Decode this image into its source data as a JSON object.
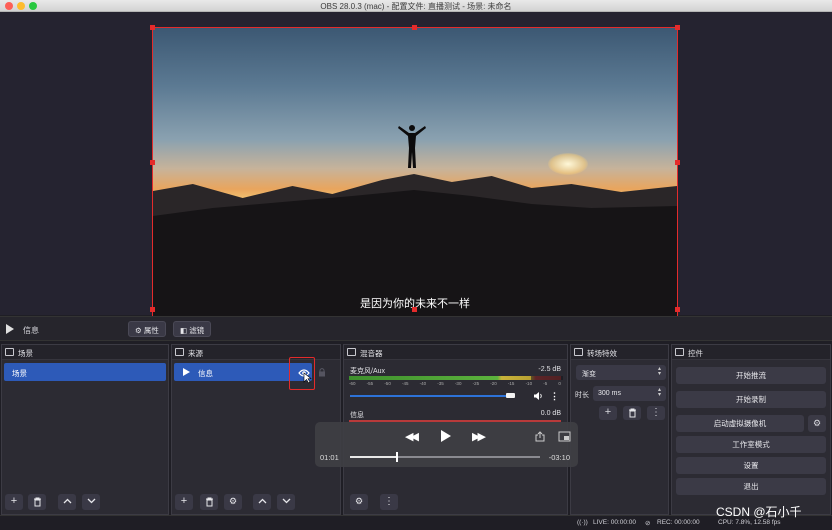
{
  "window": {
    "title": "OBS 28.0.3 (mac) - 配置文件: 直播测试 - 场景: 未命名"
  },
  "preview": {
    "subtitle": "是因为你的未来不一样"
  },
  "context_bar": {
    "source_name": "信息",
    "properties_label": "属性",
    "filters_label": "滤镜"
  },
  "docks": {
    "scenes": {
      "title": "场景",
      "items": [
        {
          "label": "场景",
          "selected": true
        }
      ]
    },
    "sources": {
      "title": "来源",
      "items": [
        {
          "label": "信息",
          "selected": true,
          "visible": true,
          "locked": false
        }
      ]
    },
    "mixer": {
      "title": "混音器",
      "channels": [
        {
          "name": "麦克风/Aux",
          "db": "-2.5 dB",
          "level": 0.85,
          "volume": 0.93
        },
        {
          "name": "信息",
          "db": "0.0 dB"
        }
      ],
      "ticks": [
        "-60",
        "-55",
        "-50",
        "-45",
        "-40",
        "-35",
        "-30",
        "-25",
        "-20",
        "-15",
        "-10",
        "-5",
        "0"
      ]
    },
    "transitions": {
      "title": "转场特效",
      "selected": "渐变",
      "duration_label": "时长",
      "duration_value": "300 ms"
    },
    "controls": {
      "title": "控件",
      "buttons": [
        "开始推流",
        "开始录制",
        "启动虚拟摄像机",
        "工作室模式",
        "设置",
        "退出"
      ]
    }
  },
  "player": {
    "elapsed": "01:01",
    "remaining": "-03:10",
    "progress": 0.24
  },
  "status": {
    "live": "LIVE: 00:00:00",
    "rec": "REC: 00:00:00",
    "cpu": "CPU: 7.8%, 12.58 fps"
  },
  "watermark": "CSDN @石小千",
  "colors": {
    "accent": "#2d5ab8",
    "highlight_box": "#e42b2b",
    "panel": "#2c2b33"
  }
}
